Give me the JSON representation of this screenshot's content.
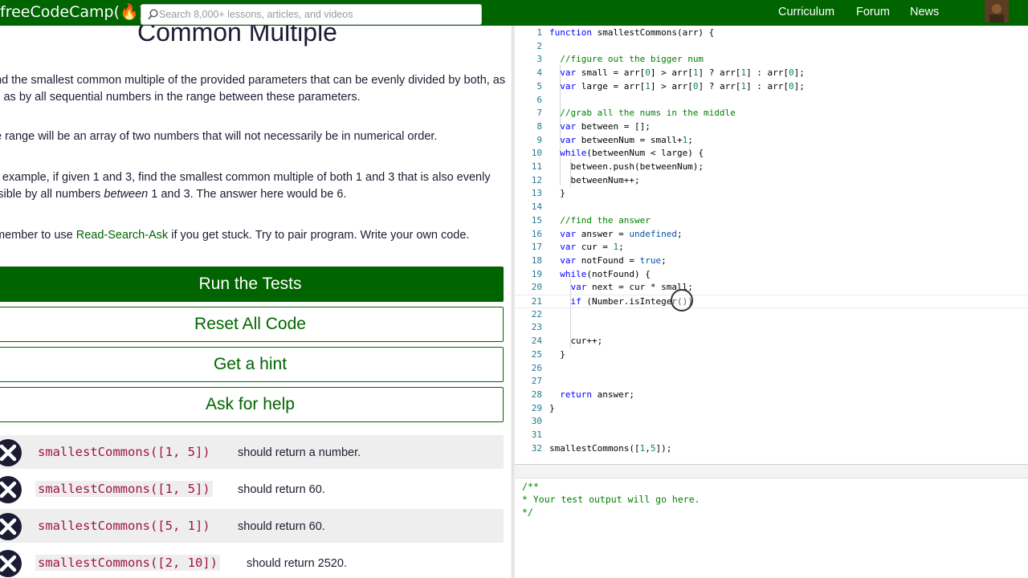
{
  "nav": {
    "logo": "freeCodeCamp(🔥)",
    "search_placeholder": "Search 8,000+ lessons, articles, and videos",
    "links": [
      "Curriculum",
      "Forum",
      "News"
    ]
  },
  "challenge": {
    "title": "Common Multiple",
    "p1": "nd the smallest common multiple of the provided parameters that can be evenly divided by both, as ll as by all sequential numbers in the range between these parameters.",
    "p2": "e range will be an array of two numbers that will not necessarily be in numerical order.",
    "p3_a": "r example, if given 1 and 3, find the smallest common multiple of both 1 and 3 that is also evenly isible by all numbers ",
    "p3_em": "between",
    "p3_b": " 1 and 3. The answer here would be 6.",
    "p4_a": "member to use ",
    "p4_link": "Read-Search-Ask",
    "p4_b": " if you get stuck. Try to pair program. Write your own code."
  },
  "buttons": {
    "run": "Run the Tests",
    "reset": "Reset All Code",
    "hint": "Get a hint",
    "help": "Ask for help"
  },
  "tests": [
    {
      "code": "smallestCommons([1, 5])",
      "desc": "should return a number."
    },
    {
      "code": "smallestCommons([1, 5])",
      "desc": "should return 60."
    },
    {
      "code": "smallestCommons([5, 1])",
      "desc": "should return 60."
    },
    {
      "code": "smallestCommons([2, 10])",
      "desc": "should return 2520."
    }
  ],
  "editor": {
    "lines": [
      "function smallestCommons(arr) {",
      "",
      "  //figure out the bigger num",
      "  var small = arr[0] > arr[1] ? arr[1] : arr[0];",
      "  var large = arr[1] > arr[0] ? arr[1] : arr[0];",
      "",
      "  //grab all the nums in the middle",
      "  var between = [];",
      "  var betweenNum = small+1;",
      "  while(betweenNum < large) {",
      "    between.push(betweenNum);",
      "    betweenNum++;",
      "  }",
      "",
      "  //find the answer",
      "  var answer = undefined;",
      "  var cur = 1;",
      "  var notFound = true;",
      "  while(notFound) {",
      "    var next = cur * small;",
      "    if (Number.isInteger())",
      "",
      "",
      "    cur++;",
      "  }",
      "",
      "",
      "  return answer;",
      "}",
      "",
      "",
      "smallestCommons([1,5]);"
    ],
    "active_line": 21
  },
  "output": {
    "lines": [
      "/**",
      "* Your test output will go here.",
      "*/"
    ]
  },
  "colors": {
    "brand_green": "#006400",
    "test_fail": "#1b1b32",
    "code_red": "#a0143c"
  }
}
